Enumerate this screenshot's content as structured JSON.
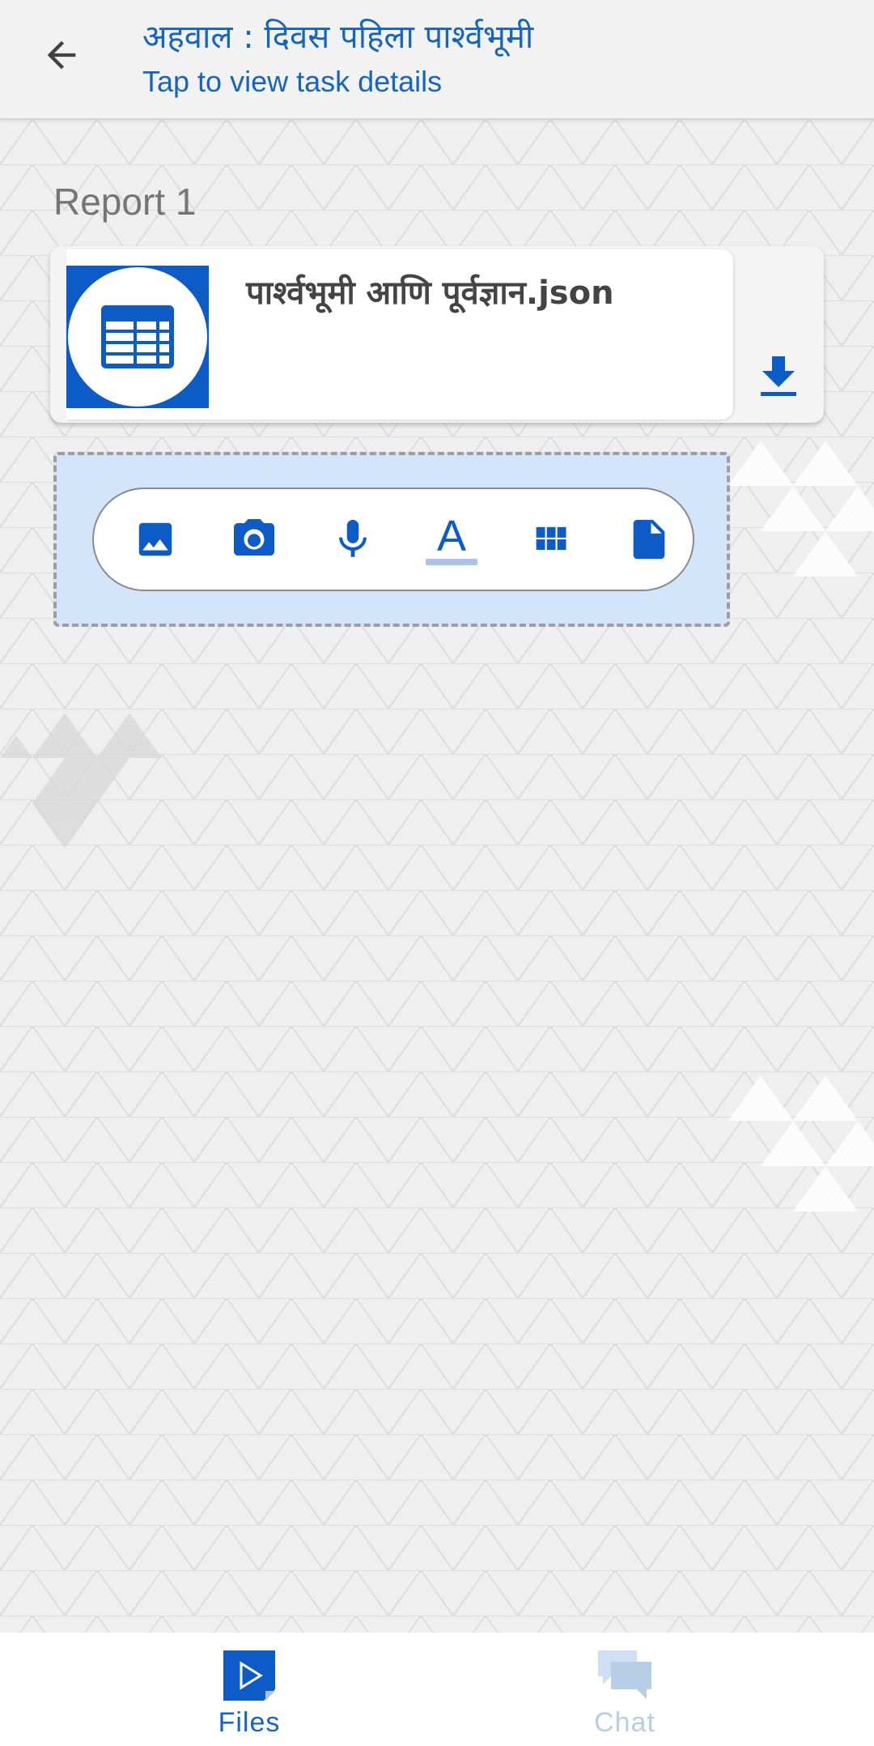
{
  "header": {
    "title": "अहवाल : दिवस पहिला पार्श्वभूमी",
    "subtitle": "Tap to view task details",
    "back_icon": "arrow-left-icon"
  },
  "report": {
    "label": "Report 1",
    "file": {
      "name": "पार्श्वभूमी आणि पूर्वज्ञान.json",
      "thumbnail_icon": "table-icon",
      "action_icon": "download-icon"
    }
  },
  "input_toolbar": {
    "tools": [
      {
        "icon": "image-icon"
      },
      {
        "icon": "camera-icon"
      },
      {
        "icon": "microphone-icon"
      },
      {
        "icon": "text-icon",
        "glyph": "A"
      },
      {
        "icon": "grid-icon"
      },
      {
        "icon": "document-icon"
      }
    ]
  },
  "bottom_nav": {
    "items": [
      {
        "label": "Files",
        "icon": "files-icon",
        "active": true
      },
      {
        "label": "Chat",
        "icon": "chat-icon",
        "active": false
      }
    ]
  },
  "colors": {
    "accent": "#1565c0",
    "thumb_bg": "#0d5bc6",
    "input_bg": "#d2e5fa",
    "chat_inactive": "#b8cde6"
  }
}
